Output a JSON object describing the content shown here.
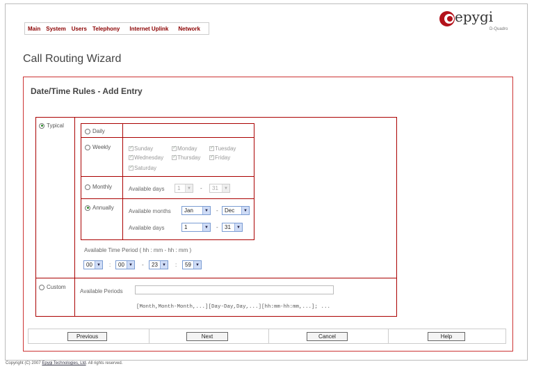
{
  "nav": {
    "items": [
      "Main",
      "System",
      "Users",
      "Telephony",
      "Internet Uplink",
      "Network"
    ]
  },
  "logo": {
    "name": "epygi",
    "sub": "D-Quadro"
  },
  "page": {
    "title": "Call Routing Wizard"
  },
  "form": {
    "section_title": "Date/Time Rules - Add Entry",
    "typical_label": "Typical",
    "custom_label": "Custom",
    "daily_label": "Daily",
    "weekly_label": "Weekly",
    "monthly_label": "Monthly",
    "annually_label": "Annually",
    "weekdays": [
      "Sunday",
      "Monday",
      "Tuesday",
      "Wednesday",
      "Thursday",
      "Friday",
      "Saturday"
    ],
    "monthly": {
      "available_days_label": "Available days",
      "from": "1",
      "to": "31"
    },
    "annually": {
      "available_months_label": "Available months",
      "month_from": "Jan",
      "month_to": "Dec",
      "available_days_label": "Available days",
      "day_from": "1",
      "day_to": "31"
    },
    "time_period": {
      "label": "Available Time Period ( hh : mm - hh : mm )",
      "h1": "00",
      "m1": "00",
      "h2": "23",
      "m2": "59"
    },
    "custom": {
      "available_periods_label": "Available Periods",
      "value": "",
      "hint": "[Month,Month-Month,...][Day-Day,Day,...][hh:mm-hh:mm,...]; ..."
    }
  },
  "buttons": {
    "previous": "Previous",
    "next": "Next",
    "cancel": "Cancel",
    "help": "Help"
  },
  "footer": {
    "prefix": "Copyright (C) 2007 ",
    "company": "Epygi Technologies, Ltd",
    "suffix": ". All rights reserved."
  }
}
